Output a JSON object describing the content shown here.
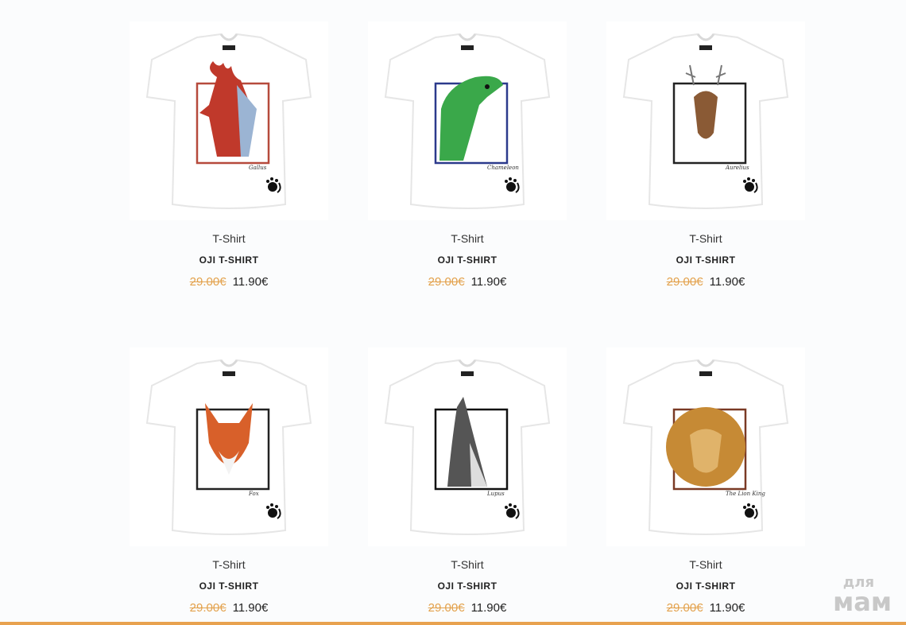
{
  "products": [
    {
      "category": "T-Shirt",
      "name": "OJI T-SHIRT",
      "old_price": "29.00€",
      "price": "11.90€",
      "art": "rooster",
      "frame": "#b64a3c",
      "accent": "#c0392b",
      "script": "Gallus"
    },
    {
      "category": "T-Shirt",
      "name": "OJI T-SHIRT",
      "old_price": "29.00€",
      "price": "11.90€",
      "art": "iguana",
      "frame": "#2c3a8c",
      "accent": "#3aa84a",
      "script": "Chameleon"
    },
    {
      "category": "T-Shirt",
      "name": "OJI T-SHIRT",
      "old_price": "29.00€",
      "price": "11.90€",
      "art": "deer",
      "frame": "#222222",
      "accent": "#8a5a35",
      "script": "Aurelius"
    },
    {
      "category": "T-Shirt",
      "name": "OJI T-SHIRT",
      "old_price": "29.00€",
      "price": "11.90€",
      "art": "fox",
      "frame": "#222222",
      "accent": "#d8602a",
      "script": "Fox"
    },
    {
      "category": "T-Shirt",
      "name": "OJI T-SHIRT",
      "old_price": "29.00€",
      "price": "11.90€",
      "art": "wolf",
      "frame": "#111111",
      "accent": "#555555",
      "script": "Lupus"
    },
    {
      "category": "T-Shirt",
      "name": "OJI T-SHIRT",
      "old_price": "29.00€",
      "price": "11.90€",
      "art": "lion",
      "frame": "#7a3a25",
      "accent": "#c68a35",
      "script": "The Lion King"
    }
  ],
  "watermark": {
    "line1": "для",
    "line2": "мам"
  }
}
